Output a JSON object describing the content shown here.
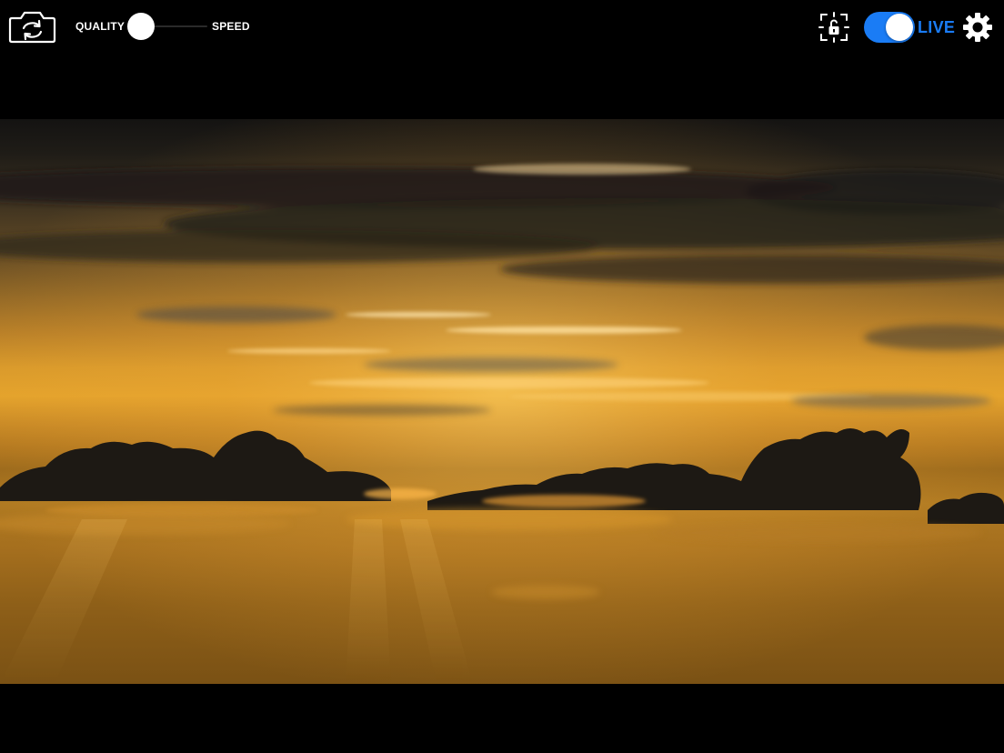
{
  "toolbar": {
    "camera_switch_icon": "camera-rotate-icon",
    "quality_label": "QUALITY",
    "speed_label": "SPEED",
    "quality_speed_value": 0.17,
    "focus_lock_icon": "focus-lock-icon",
    "live_label": "LIVE",
    "live_enabled": true,
    "settings_icon": "gear-icon"
  },
  "colors": {
    "accent": "#1a7cf5",
    "background": "#000000",
    "icon": "#ffffff"
  }
}
